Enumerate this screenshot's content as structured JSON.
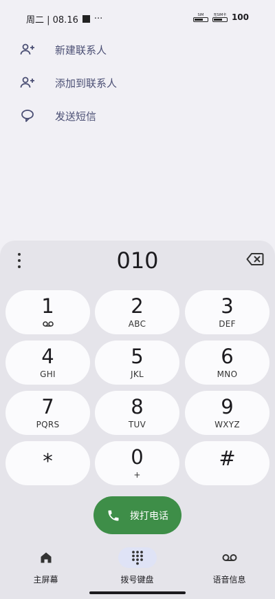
{
  "status_bar": {
    "datetime": "周二 | 08.16",
    "more": "···",
    "sim_label": "SIM",
    "sim2_label": "无SIM卡",
    "battery": "100"
  },
  "suggestions": [
    {
      "label": "新建联系人",
      "icon": "person-add-icon"
    },
    {
      "label": "添加到联系人",
      "icon": "person-add-icon"
    },
    {
      "label": "发送短信",
      "icon": "message-bubble-icon"
    }
  ],
  "dialer": {
    "number": "010",
    "keys": [
      {
        "digit": "1",
        "letters": "",
        "icon": "voicemail-icon"
      },
      {
        "digit": "2",
        "letters": "ABC"
      },
      {
        "digit": "3",
        "letters": "DEF"
      },
      {
        "digit": "4",
        "letters": "GHI"
      },
      {
        "digit": "5",
        "letters": "JKL"
      },
      {
        "digit": "6",
        "letters": "MNO"
      },
      {
        "digit": "7",
        "letters": "PQRS"
      },
      {
        "digit": "8",
        "letters": "TUV"
      },
      {
        "digit": "9",
        "letters": "WXYZ"
      },
      {
        "digit": "*",
        "letters": ""
      },
      {
        "digit": "0",
        "letters": "+"
      },
      {
        "digit": "#",
        "letters": ""
      }
    ],
    "call_label": "拨打电话"
  },
  "nav": [
    {
      "label": "主屏幕",
      "icon": "home-icon",
      "active": false
    },
    {
      "label": "拨号键盘",
      "icon": "dialpad-icon",
      "active": true
    },
    {
      "label": "语音信息",
      "icon": "voicemail-icon",
      "active": false
    }
  ],
  "colors": {
    "background": "#f1f0f5",
    "dialpad": "#e5e4ea",
    "key": "#fbfbfd",
    "call": "#3e8e48",
    "accent_text": "#4b4f74",
    "nav_active": "#dfe3f6"
  }
}
